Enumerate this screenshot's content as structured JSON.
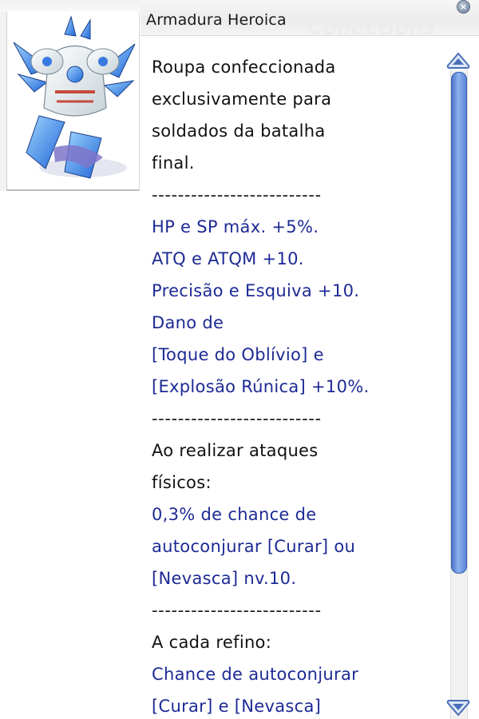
{
  "window": {
    "title": "Armadura Heroica",
    "watermark": "Collections",
    "close_glyph": "×"
  },
  "item": {
    "icon": "armor-icon",
    "description": [
      "Roupa confeccionada",
      "exclusivamente para",
      "soldados da batalha",
      "final."
    ],
    "separator": "--------------------------",
    "bonuses": [
      "HP e SP máx. +5%.",
      "ATQ e ATQM +10.",
      "Precisão e Esquiva +10.",
      "Dano de",
      "[Toque do Oblívio] e",
      "[Explosão Rúnica] +10%."
    ],
    "physical_attack_header": [
      "Ao realizar ataques",
      "físicos:"
    ],
    "physical_attack_effect": [
      "0,3% de chance de",
      "autoconjurar [Curar] ou",
      "[Nevasca] nv.10."
    ],
    "refine_header": "A cada refino:",
    "refine_effect": [
      "Chance de autoconjurar",
      "[Curar] e [Nevasca]"
    ]
  },
  "colors": {
    "effect_text": "#1d2a94",
    "plain_text": "#111111",
    "scroll_thumb": "#5c85d6"
  },
  "scrollbar": {
    "up_icon": "arrow-up-icon",
    "down_icon": "arrow-down-icon"
  }
}
